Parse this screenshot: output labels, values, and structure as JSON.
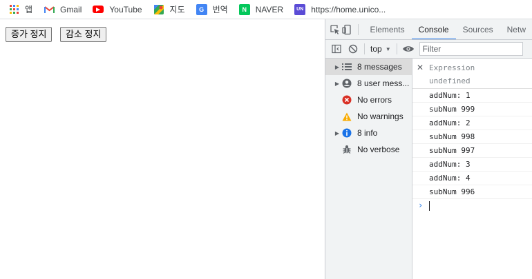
{
  "bookmarks": [
    {
      "label": "앱",
      "icon": "apps-grid-icon"
    },
    {
      "label": "Gmail",
      "icon": "gmail-icon"
    },
    {
      "label": "YouTube",
      "icon": "youtube-icon"
    },
    {
      "label": "지도",
      "icon": "maps-icon"
    },
    {
      "label": "번역",
      "icon": "translate-icon"
    },
    {
      "label": "NAVER",
      "icon": "naver-icon",
      "icon_text": "N"
    },
    {
      "label": "https://home.unico...",
      "icon": "unico-icon",
      "icon_text": "UN"
    }
  ],
  "page": {
    "buttons": [
      "증가 정지",
      "감소 정지"
    ]
  },
  "devtools": {
    "tabs": [
      "Elements",
      "Console",
      "Sources",
      "Netw"
    ],
    "active_tab": "Console",
    "toolbar": {
      "context": "top",
      "filter_placeholder": "Filter"
    },
    "sidebar": [
      {
        "label": "8 messages",
        "icon": "list-icon",
        "expandable": true,
        "selected": true
      },
      {
        "label": "8 user mess...",
        "icon": "user-icon",
        "expandable": true,
        "selected": false
      },
      {
        "label": "No errors",
        "icon": "error-icon",
        "expandable": false,
        "selected": false
      },
      {
        "label": "No warnings",
        "icon": "warning-icon",
        "expandable": false,
        "selected": false
      },
      {
        "label": "8 info",
        "icon": "info-icon",
        "expandable": true,
        "selected": false
      },
      {
        "label": "No verbose",
        "icon": "bug-icon",
        "expandable": false,
        "selected": false
      }
    ],
    "expression": {
      "label": "Expression",
      "value": "undefined"
    },
    "logs": [
      "addNum: 1",
      "subNum 999",
      "addNum: 2",
      "subNum 998",
      "subNum 997",
      "addNum: 3",
      "addNum: 4",
      "subNum 996"
    ]
  },
  "colors": {
    "accent": "#1a73e8",
    "gmail_red": "#ea4335",
    "youtube_red": "#ff0000",
    "naver_green": "#03c75a",
    "unico_purple": "#5b4cd6",
    "error_red": "#d93025",
    "warning_yellow": "#f9ab00",
    "info_blue": "#1a73e8"
  }
}
